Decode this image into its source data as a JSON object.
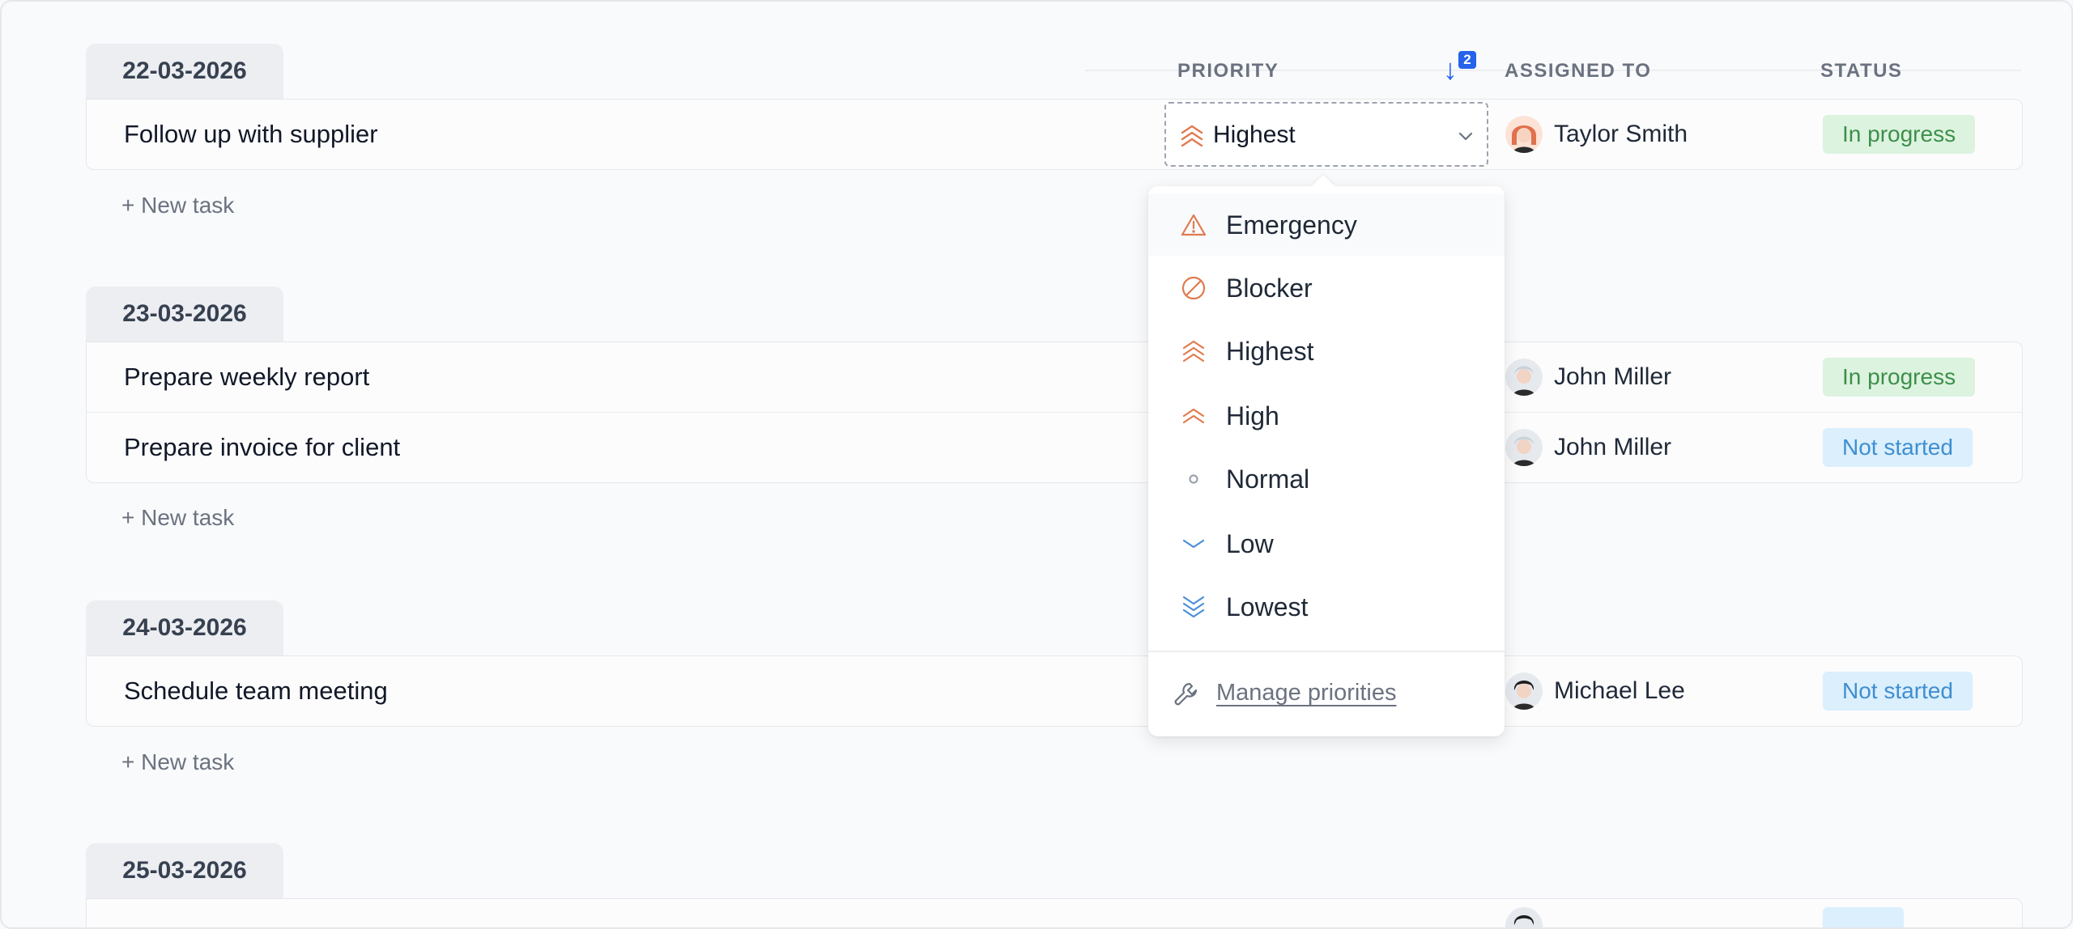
{
  "columns": {
    "priority": "PRIORITY",
    "assigned_to": "ASSIGNED TO",
    "status": "STATUS"
  },
  "sort": {
    "direction_icon": "arrow-down-icon",
    "badge": "2"
  },
  "colors": {
    "accent": "#2563eb",
    "priority_high": "#e07b4f",
    "priority_low": "#4a8fd6",
    "status_green": "#3d8f4a",
    "status_blue": "#3f8ed0"
  },
  "groups": [
    {
      "date": "22-03-2026",
      "new_task": "+ New task",
      "tasks": [
        {
          "title": "Follow up with supplier",
          "priority": "Highest",
          "assignee": "Taylor Smith",
          "status": "In progress",
          "status_color": "green"
        }
      ]
    },
    {
      "date": "23-03-2026",
      "new_task": "+ New task",
      "tasks": [
        {
          "title": "Prepare weekly report",
          "assignee": "John Miller",
          "status": "In progress",
          "status_color": "green"
        },
        {
          "title": "Prepare invoice for client",
          "assignee": "John Miller",
          "status": "Not started",
          "status_color": "blue"
        }
      ]
    },
    {
      "date": "24-03-2026",
      "new_task": "+ New task",
      "tasks": [
        {
          "title": "Schedule team meeting",
          "assignee": "Michael Lee",
          "status": "Not started",
          "status_color": "blue"
        }
      ]
    },
    {
      "date": "25-03-2026",
      "tasks": []
    }
  ],
  "priority_select": {
    "value": "Highest",
    "icon": "chevrons-up-triple-icon"
  },
  "priority_options": [
    {
      "label": "Emergency",
      "icon": "warning-triangle-icon"
    },
    {
      "label": "Blocker",
      "icon": "blocked-circle-icon"
    },
    {
      "label": "Highest",
      "icon": "chevrons-up-triple-icon"
    },
    {
      "label": "High",
      "icon": "chevrons-up-double-icon"
    },
    {
      "label": "Normal",
      "icon": "circle-dot-icon"
    },
    {
      "label": "Low",
      "icon": "chevron-down-icon"
    },
    {
      "label": "Lowest",
      "icon": "chevrons-down-triple-icon"
    }
  ],
  "manage_priorities": {
    "label": "Manage priorities",
    "icon": "wrench-icon"
  }
}
